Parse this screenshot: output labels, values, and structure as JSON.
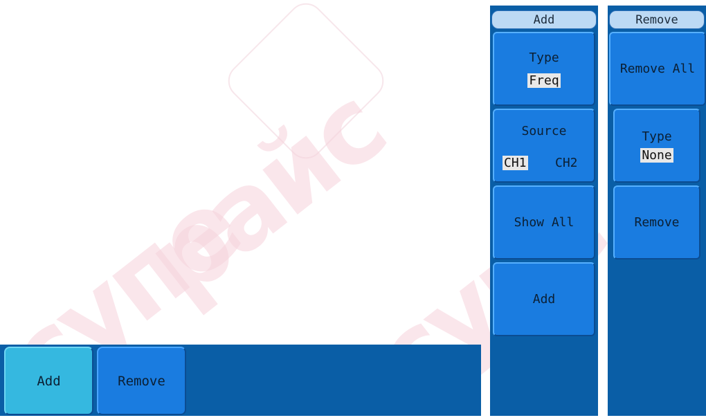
{
  "bottom_bar": {
    "buttons": [
      {
        "label": "Add",
        "active": true
      },
      {
        "label": "Remove",
        "active": false
      }
    ]
  },
  "add_panel": {
    "title": "Add",
    "type_label": "Type",
    "type_value": "Freq",
    "source_label": "Source",
    "source_options": [
      "CH1",
      "CH2"
    ],
    "source_selected": "CH1",
    "show_all_label": "Show All",
    "add_label": "Add"
  },
  "remove_panel": {
    "title": "Remove",
    "remove_all_label": "Remove All",
    "type_label": "Type",
    "type_value": "None",
    "remove_label": "Remove"
  },
  "colors": {
    "panel_bg": "#0a5ea6",
    "button_bg": "#1a7ce0",
    "active_button_bg": "#35b8e0",
    "title_bg": "#bcd9f4"
  },
  "watermark": "cynepoйc"
}
